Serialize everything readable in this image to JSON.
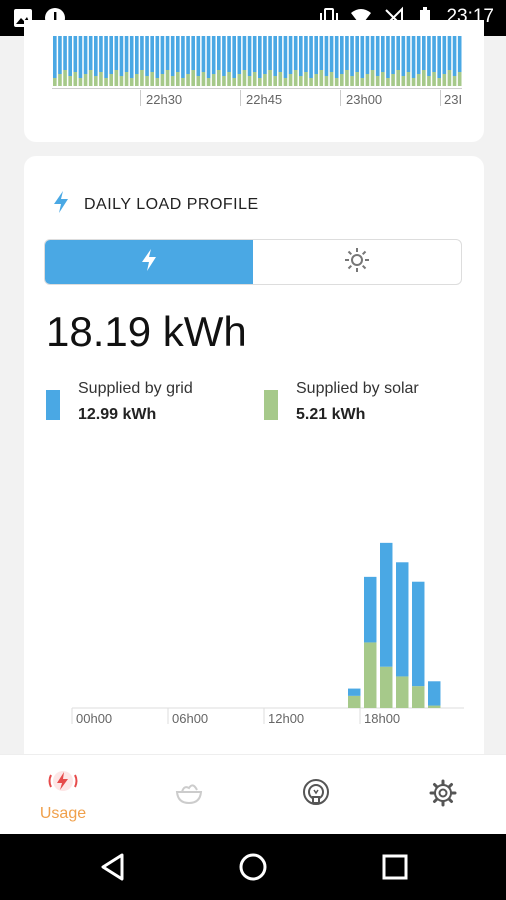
{
  "status_bar": {
    "time": "23:17"
  },
  "top_chart": {
    "ticks": [
      "22h30",
      "22h45",
      "23h00",
      "23I"
    ]
  },
  "daily_load": {
    "title": "DAILY LOAD PROFILE",
    "total": "18.19 kWh",
    "legend": [
      {
        "label": "Supplied by grid",
        "value": "12.99 kWh",
        "color": "#4aa8e4"
      },
      {
        "label": "Supplied by solar",
        "value": "5.21 kWh",
        "color": "#a6c98a"
      }
    ]
  },
  "chart_data": {
    "type": "bar",
    "stacked": true,
    "x_tick_labels": [
      "00h00",
      "06h00",
      "12h00",
      "18h00"
    ],
    "categories": [
      "17h",
      "18h",
      "19h",
      "20h",
      "21h",
      "22h",
      "23h"
    ],
    "series": [
      {
        "name": "Supplied by solar",
        "color": "#a6c98a",
        "values": [
          0.25,
          1.35,
          0.85,
          0.65,
          0.45,
          0.05,
          0.0
        ]
      },
      {
        "name": "Supplied by grid",
        "color": "#4aa8e4",
        "values": [
          0.15,
          1.35,
          2.55,
          2.35,
          2.15,
          0.5,
          0.0
        ]
      }
    ],
    "ylim": [
      0,
      3.5
    ]
  },
  "bottom_nav": {
    "usage_label": "Usage"
  },
  "colors": {
    "accent": "#4aa8e4",
    "solar": "#a6c98a",
    "nav_active": "#f0a04b"
  }
}
